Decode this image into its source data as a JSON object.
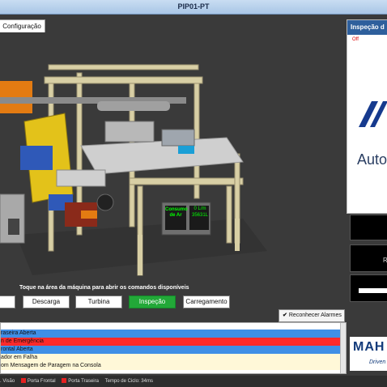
{
  "window": {
    "title": "PIP01-PT"
  },
  "toolbar": {
    "config_label": "Configuração"
  },
  "side_panel": {
    "title": "Inspeção d",
    "state": "Off",
    "brand_word": "Auto",
    "black_label": "R"
  },
  "scene": {
    "hint": "Toque na área da máquina para abrir os comandos disponíveis",
    "meter_label_1": "Consumo",
    "meter_label_2": "de Ar",
    "meter_val_1": "0 L/m",
    "meter_val_2": "35631L"
  },
  "modes": [
    {
      "label": ""
    },
    {
      "label": "Descarga"
    },
    {
      "label": "Turbina"
    },
    {
      "label": "Inspeção",
      "active": true
    },
    {
      "label": "Carregamento"
    }
  ],
  "alarms_ack": {
    "label": "Reconhecer Alarmes"
  },
  "alarms": [
    {
      "text": "raseira Aberta",
      "color": "blue"
    },
    {
      "text": "n de Emergência",
      "color": "red"
    },
    {
      "text": "rontal Aberta",
      "color": "blue"
    },
    {
      "text": "ador em Falha",
      "color": "yellow"
    },
    {
      "text": "om Mensagem de Paragem na Consola",
      "color": "yellow"
    }
  ],
  "logo": {
    "text": "MAH",
    "sub": "Driven"
  },
  "status": {
    "part1": ". Visão",
    "part2": "Porta Frontal",
    "part3": "Porta Traseira",
    "part4": "Tempo de Ciclo: 34ms"
  },
  "colors": {
    "accent": "#2e5f9c",
    "active_mode": "#22a838",
    "alarm_red": "#ff2a2a",
    "alarm_blue": "#3f8fe6"
  }
}
